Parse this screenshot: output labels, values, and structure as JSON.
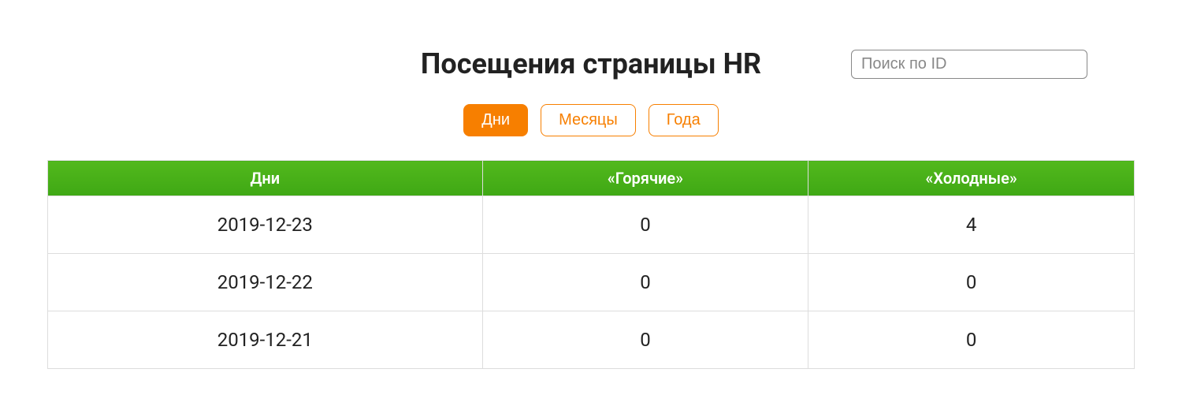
{
  "header": {
    "title": "Посещения страницы HR",
    "search_placeholder": "Поиск по ID"
  },
  "tabs": {
    "days": "Дни",
    "months": "Месяцы",
    "years": "Года",
    "active": "days"
  },
  "table": {
    "headers": {
      "date": "Дни",
      "hot": "«Горячие»",
      "cold": "«Холодные»"
    },
    "rows": [
      {
        "date": "2019-12-23",
        "hot": "0",
        "cold": "4"
      },
      {
        "date": "2019-12-22",
        "hot": "0",
        "cold": "0"
      },
      {
        "date": "2019-12-21",
        "hot": "0",
        "cold": "0"
      }
    ]
  },
  "colors": {
    "accent_orange": "#f77f00",
    "header_green": "#4CAF1A"
  }
}
